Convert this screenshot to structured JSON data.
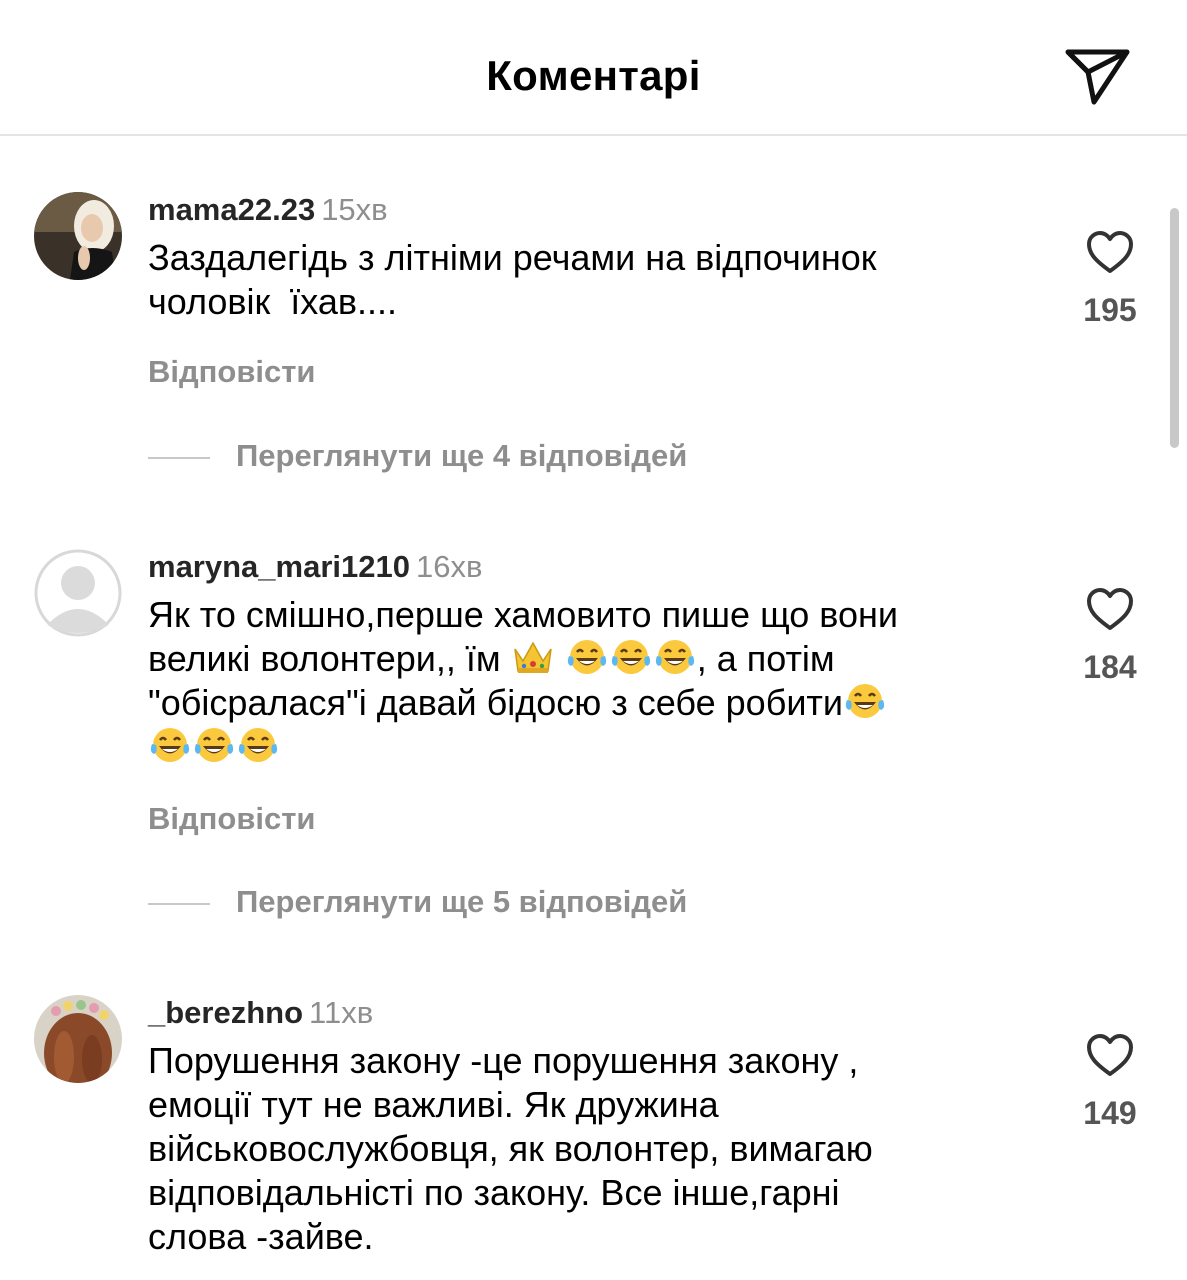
{
  "header": {
    "title": "Коментарі",
    "icons": {
      "send": "send-icon"
    }
  },
  "colors": {
    "username": "#262626",
    "secondary_text": "#8e8e8e",
    "divider": "#e4e4e4",
    "like_count": "#555555"
  },
  "comments": [
    {
      "username": "mama22.23",
      "time": "15хв",
      "text_parts": [
        "Заздалегідь з літніми речами на відпочинок\nчоловік  їхав...."
      ],
      "reply_label": "Відповісти",
      "likes": "195",
      "view_replies": "Переглянути ще 4 відповідей",
      "avatar": "photo-avatar-blonde"
    },
    {
      "username": "maryna_mari1210",
      "time": "16хв",
      "text_parts": [
        "Як то смішно,перше хамовито пише що вони\nвеликі волонтери,, їм ",
        " ",
        ", а потім\n\"обісралася\"і давай бідосю з себе робити"
      ],
      "emojis": [
        "crown-emoji",
        "laughing-tears-emoji"
      ],
      "reply_label": "Відповісти",
      "likes": "184",
      "view_replies": "Переглянути ще 5 відповідей",
      "avatar": "default-avatar"
    },
    {
      "username": "_berezhno",
      "time": "11хв",
      "text_parts": [
        "Порушення закону -це порушення закону ,\nемоції тут не важливі. Як дружина\nвійськовослужбовця, як волонтер, вимагаю\nвідповідальністі по закону. Все інше,гарні\nслова -зайве."
      ],
      "likes": "149",
      "avatar": "photo-avatar-flower-crown"
    }
  ]
}
